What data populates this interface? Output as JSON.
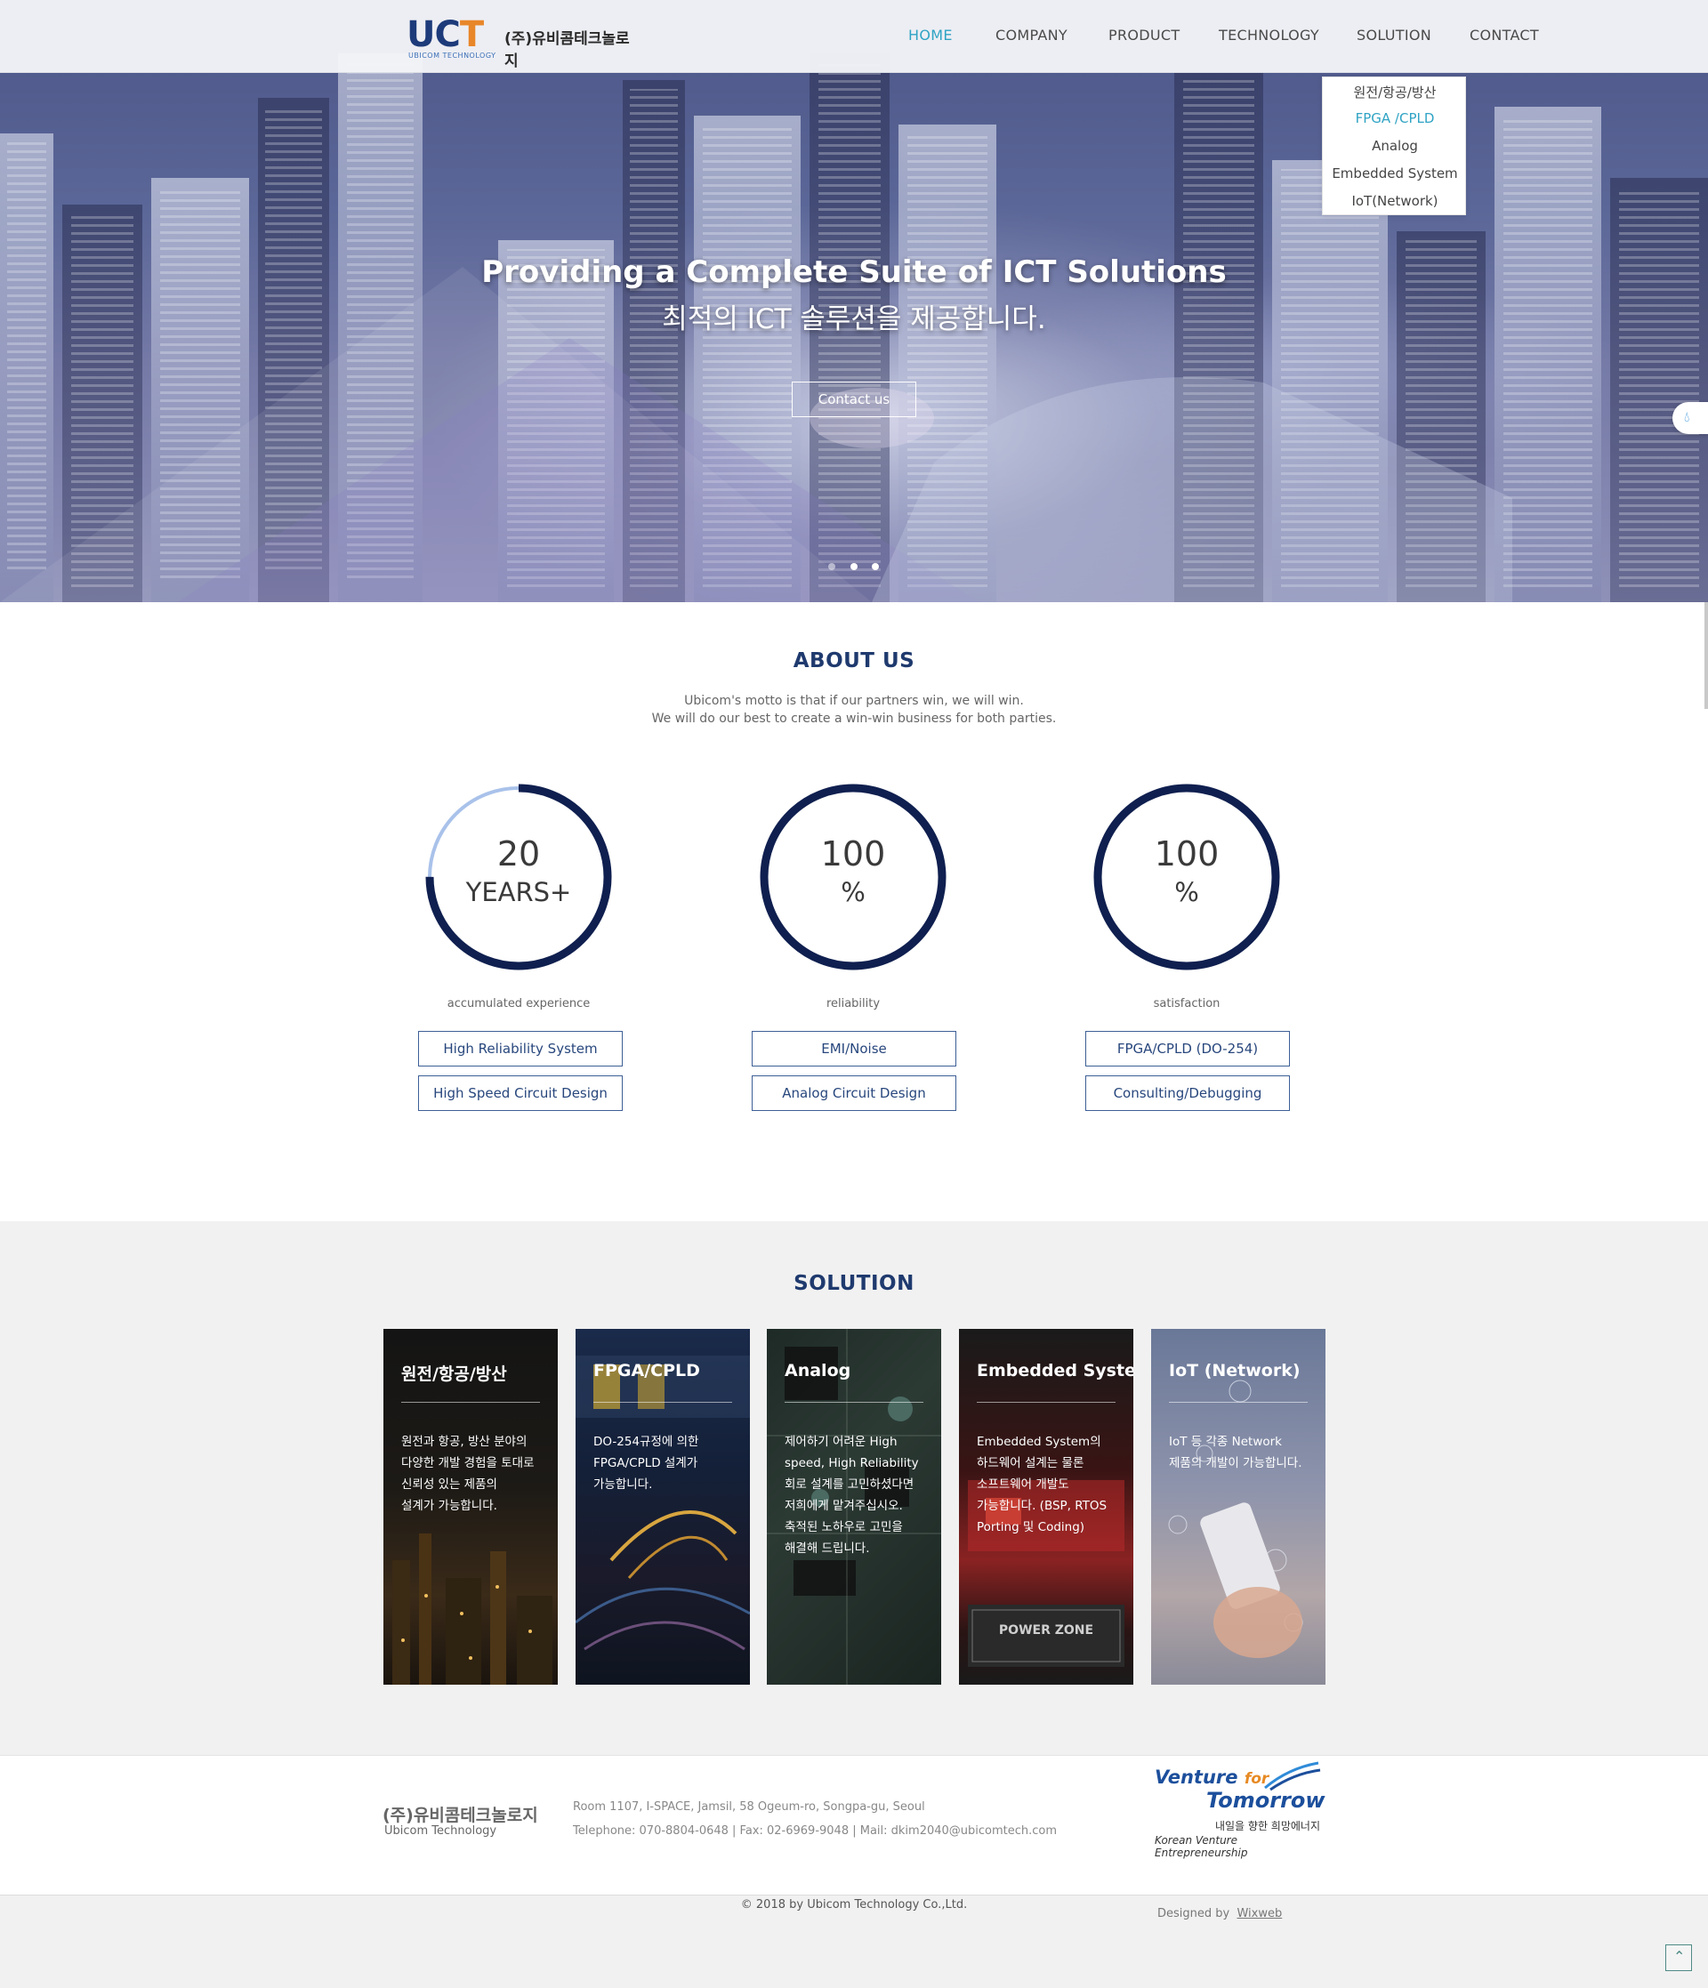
{
  "header": {
    "logo_mark_u": "UC",
    "logo_mark_t": "T",
    "logo_sub": "UBICOM TECHNOLOGY",
    "logo_kr": "(주)유비콤테크놀로지",
    "nav": [
      "HOME",
      "COMPANY",
      "PRODUCT",
      "TECHNOLOGY",
      "SOLUTION",
      "CONTACT"
    ],
    "active_nav": "HOME"
  },
  "submenu": {
    "items": [
      "원전/항공/방산",
      "FPGA /CPLD",
      "Analog",
      "Embedded System",
      "IoT(Network)"
    ],
    "active": "FPGA /CPLD"
  },
  "hero": {
    "title": "Providing a Complete Suite of ICT Solutions",
    "subtitle": "최적의 ICT 솔루션을 제공합니다.",
    "cta": "Contact us",
    "slide_count": 3,
    "active_slide": 2
  },
  "about": {
    "title": "ABOUT US",
    "line1": "Ubicom's motto is that if our partners win, we will win.",
    "line2": "We will do our best to create a win-win business for both parties.",
    "stats": [
      {
        "value": "20",
        "unit": "YEARS+",
        "caption": "accumulated experience",
        "progress": 0.75
      },
      {
        "value": "100",
        "unit": "%",
        "caption": "reliability",
        "progress": 1.0
      },
      {
        "value": "100",
        "unit": "%",
        "caption": "satisfaction",
        "progress": 1.0
      }
    ],
    "buttons": [
      [
        "High Reliability System",
        "High Speed Circuit Design"
      ],
      [
        "EMI/Noise",
        "Analog Circuit Design"
      ],
      [
        "FPGA/CPLD (DO-254)",
        "Consulting/Debugging"
      ]
    ]
  },
  "solution": {
    "title": "SOLUTION",
    "cards": [
      {
        "title": "원전/항공/방산",
        "text": [
          "원전과 항공, 방산 분야의",
          "다양한 개발 경험을 토대로",
          "신뢰성 있는 제품의",
          "설계가 가능합니다."
        ]
      },
      {
        "title": "FPGA/CPLD",
        "text": [
          "DO-254규정에 의한",
          "FPGA/CPLD 설계가",
          "가능합니다."
        ]
      },
      {
        "title": "Analog",
        "text": [
          "제어하기 어려운 High",
          "speed, High Reliability",
          "회로 설계를 고민하셨다면",
          "저희에게 맡겨주십시오.",
          "축적된 노하우로 고민을",
          "해결해 드립니다."
        ]
      },
      {
        "title": "Embedded System",
        "text": [
          "Embedded System의",
          "하드웨어 설계는 물론",
          "소프트웨어 개발도",
          "가능합니다. (BSP, RTOS",
          "Porting 및 Coding)"
        ]
      },
      {
        "title": "IoT (Network)",
        "text": [
          "IoT 등 각종 Network",
          "제품의 개발이 가능합니다."
        ]
      }
    ],
    "embedded_label": "POWER ZONE"
  },
  "footer": {
    "company_kr": "(주)유비콤테크놀로지",
    "company_en": "Ubicom Technology",
    "address": "Room 1107, I-SPACE, Jamsil, 58 Ogeum-ro, Songpa-gu, Seoul",
    "contact": "Telephone: 070-8804-0648 | Fax: 02-6969-9048 |   Mail: dkim2040@ubicomtech.com",
    "venture_line1": "Venture",
    "venture_for": "for",
    "venture_line2": "Tomorrow",
    "venture_kr": "내일을 향한 희망에너지",
    "venture_en": "Korean Venture Entrepreneurship",
    "copyright": "© 2018 by Ubicom Technology Co.,Ltd.",
    "designed_by": "Designed by",
    "designer": "Wixweb"
  },
  "icons": {
    "top": "chevron-up-icon",
    "widget": "droplet-icon"
  },
  "colors": {
    "accent": "#2fa3c4",
    "navy": "#1f3a6e",
    "ring": "#0f1f4f",
    "ring_light": "#a9c2ea"
  }
}
